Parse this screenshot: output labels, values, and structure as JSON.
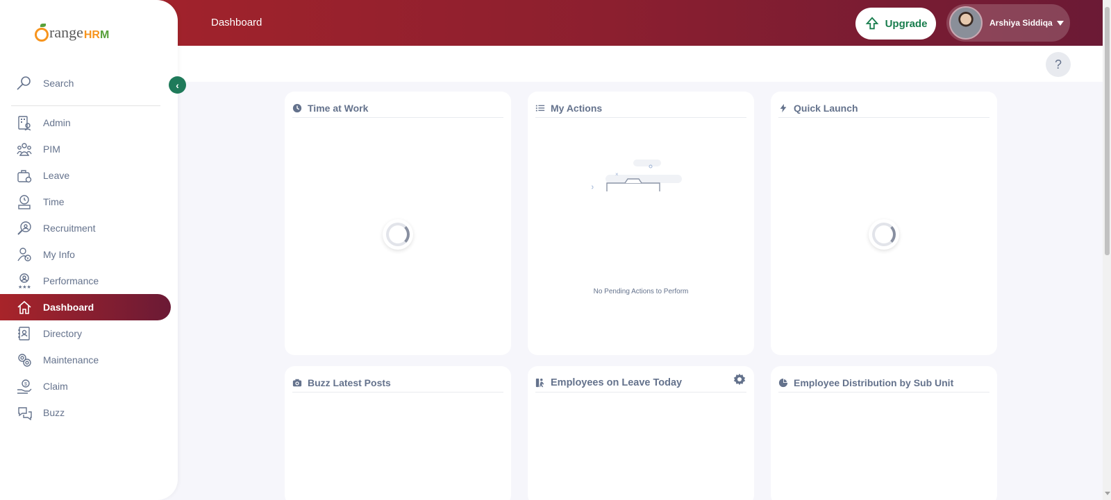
{
  "header": {
    "title": "Dashboard",
    "upgrade_label": "Upgrade",
    "user_name": "Arshiya Siddiqa"
  },
  "help": {
    "label": "?"
  },
  "sidebar": {
    "logo_prefix": "range",
    "logo_suffix_h": "HR",
    "logo_suffix_m": "M",
    "search_placeholder": "Search",
    "items": [
      {
        "label": "Admin",
        "icon": "admin-icon"
      },
      {
        "label": "PIM",
        "icon": "pim-icon"
      },
      {
        "label": "Leave",
        "icon": "leave-icon"
      },
      {
        "label": "Time",
        "icon": "time-icon"
      },
      {
        "label": "Recruitment",
        "icon": "recruitment-icon"
      },
      {
        "label": "My Info",
        "icon": "my-info-icon"
      },
      {
        "label": "Performance",
        "icon": "performance-icon"
      },
      {
        "label": "Dashboard",
        "icon": "home-icon",
        "active": true
      },
      {
        "label": "Directory",
        "icon": "directory-icon"
      },
      {
        "label": "Maintenance",
        "icon": "maintenance-icon"
      },
      {
        "label": "Claim",
        "icon": "claim-icon"
      },
      {
        "label": "Buzz",
        "icon": "buzz-icon"
      }
    ]
  },
  "cards": {
    "time_at_work": {
      "title": "Time at Work"
    },
    "my_actions": {
      "title": "My Actions",
      "empty_text": "No Pending Actions to Perform"
    },
    "quick_launch": {
      "title": "Quick Launch"
    },
    "buzz_latest_posts": {
      "title": "Buzz Latest Posts"
    },
    "employees_on_leave": {
      "title": "Employees on Leave Today"
    },
    "employee_distribution": {
      "title": "Employee Distribution by Sub Unit"
    }
  },
  "colors": {
    "brand_red": "#a8242a",
    "brand_dark": "#6b1a35",
    "accent_green": "#1f7a5a",
    "text_gray": "#64728c"
  }
}
